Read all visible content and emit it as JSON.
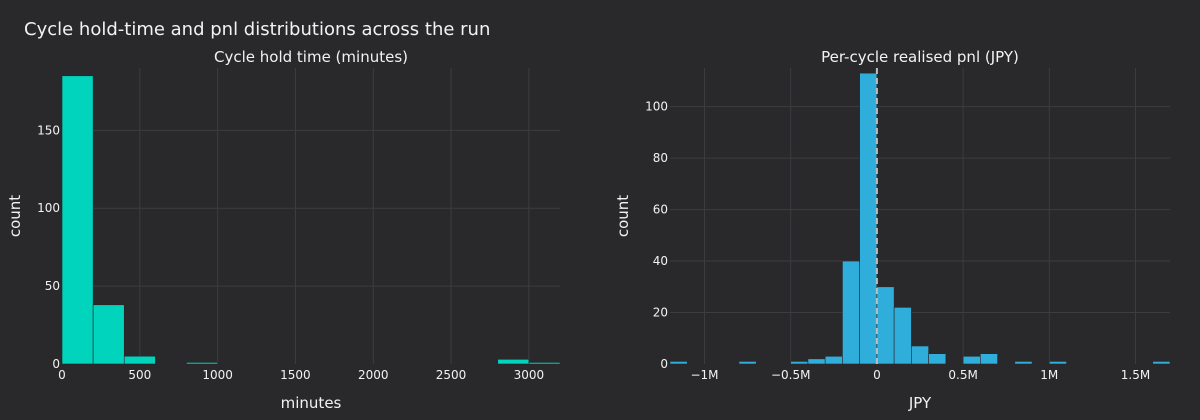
{
  "title": "Cycle hold-time and pnl distributions across the run",
  "chart_data": [
    {
      "type": "bar",
      "subtitle": "Cycle hold time (minutes)",
      "xlabel": "minutes",
      "ylabel": "count",
      "xlim": [
        0,
        3200
      ],
      "ylim": [
        0,
        190
      ],
      "xticks": [
        0,
        500,
        1000,
        1500,
        2000,
        2500,
        3000
      ],
      "xtick_labels": [
        "0",
        "500",
        "1000",
        "1500",
        "2000",
        "2500",
        "3000"
      ],
      "yticks": [
        0,
        50,
        100,
        150
      ],
      "ytick_labels": [
        "0",
        "50",
        "100",
        "150"
      ],
      "bin_width": 200,
      "bins": [
        {
          "x0": 0,
          "x1": 200,
          "count": 185
        },
        {
          "x0": 200,
          "x1": 400,
          "count": 38
        },
        {
          "x0": 400,
          "x1": 600,
          "count": 5
        },
        {
          "x0": 800,
          "x1": 1000,
          "count": 1
        },
        {
          "x0": 2800,
          "x1": 3000,
          "count": 3
        },
        {
          "x0": 3000,
          "x1": 3200,
          "count": 1
        }
      ],
      "color": "#00d4bd",
      "grid": true
    },
    {
      "type": "bar",
      "subtitle": "Per-cycle realised pnl (JPY)",
      "xlabel": "JPY",
      "ylabel": "count",
      "xlim": [
        -1200000,
        1700000
      ],
      "ylim": [
        0,
        115
      ],
      "xticks": [
        -1000000,
        -500000,
        0,
        500000,
        1000000,
        1500000
      ],
      "xtick_labels": [
        "−1M",
        "−0.5M",
        "0",
        "0.5M",
        "1M",
        "1.5M"
      ],
      "yticks": [
        0,
        20,
        40,
        60,
        80,
        100
      ],
      "ytick_labels": [
        "0",
        "20",
        "40",
        "60",
        "80",
        "100"
      ],
      "bin_width": 100000,
      "bins": [
        {
          "x0": -1200000,
          "x1": -1100000,
          "count": 1
        },
        {
          "x0": -800000,
          "x1": -700000,
          "count": 1
        },
        {
          "x0": -500000,
          "x1": -400000,
          "count": 1
        },
        {
          "x0": -400000,
          "x1": -300000,
          "count": 2
        },
        {
          "x0": -300000,
          "x1": -200000,
          "count": 3
        },
        {
          "x0": -200000,
          "x1": -100000,
          "count": 40
        },
        {
          "x0": -100000,
          "x1": 0,
          "count": 113
        },
        {
          "x0": 0,
          "x1": 100000,
          "count": 30
        },
        {
          "x0": 100000,
          "x1": 200000,
          "count": 22
        },
        {
          "x0": 200000,
          "x1": 300000,
          "count": 7
        },
        {
          "x0": 300000,
          "x1": 400000,
          "count": 4
        },
        {
          "x0": 500000,
          "x1": 600000,
          "count": 3
        },
        {
          "x0": 600000,
          "x1": 700000,
          "count": 4
        },
        {
          "x0": 800000,
          "x1": 900000,
          "count": 1
        },
        {
          "x0": 1000000,
          "x1": 1100000,
          "count": 1
        },
        {
          "x0": 1600000,
          "x1": 1700000,
          "count": 1
        }
      ],
      "color": "#30aedb",
      "zero_line": {
        "x": 0,
        "style": "dashed",
        "color": "#bdbdbd"
      },
      "grid": true
    }
  ]
}
